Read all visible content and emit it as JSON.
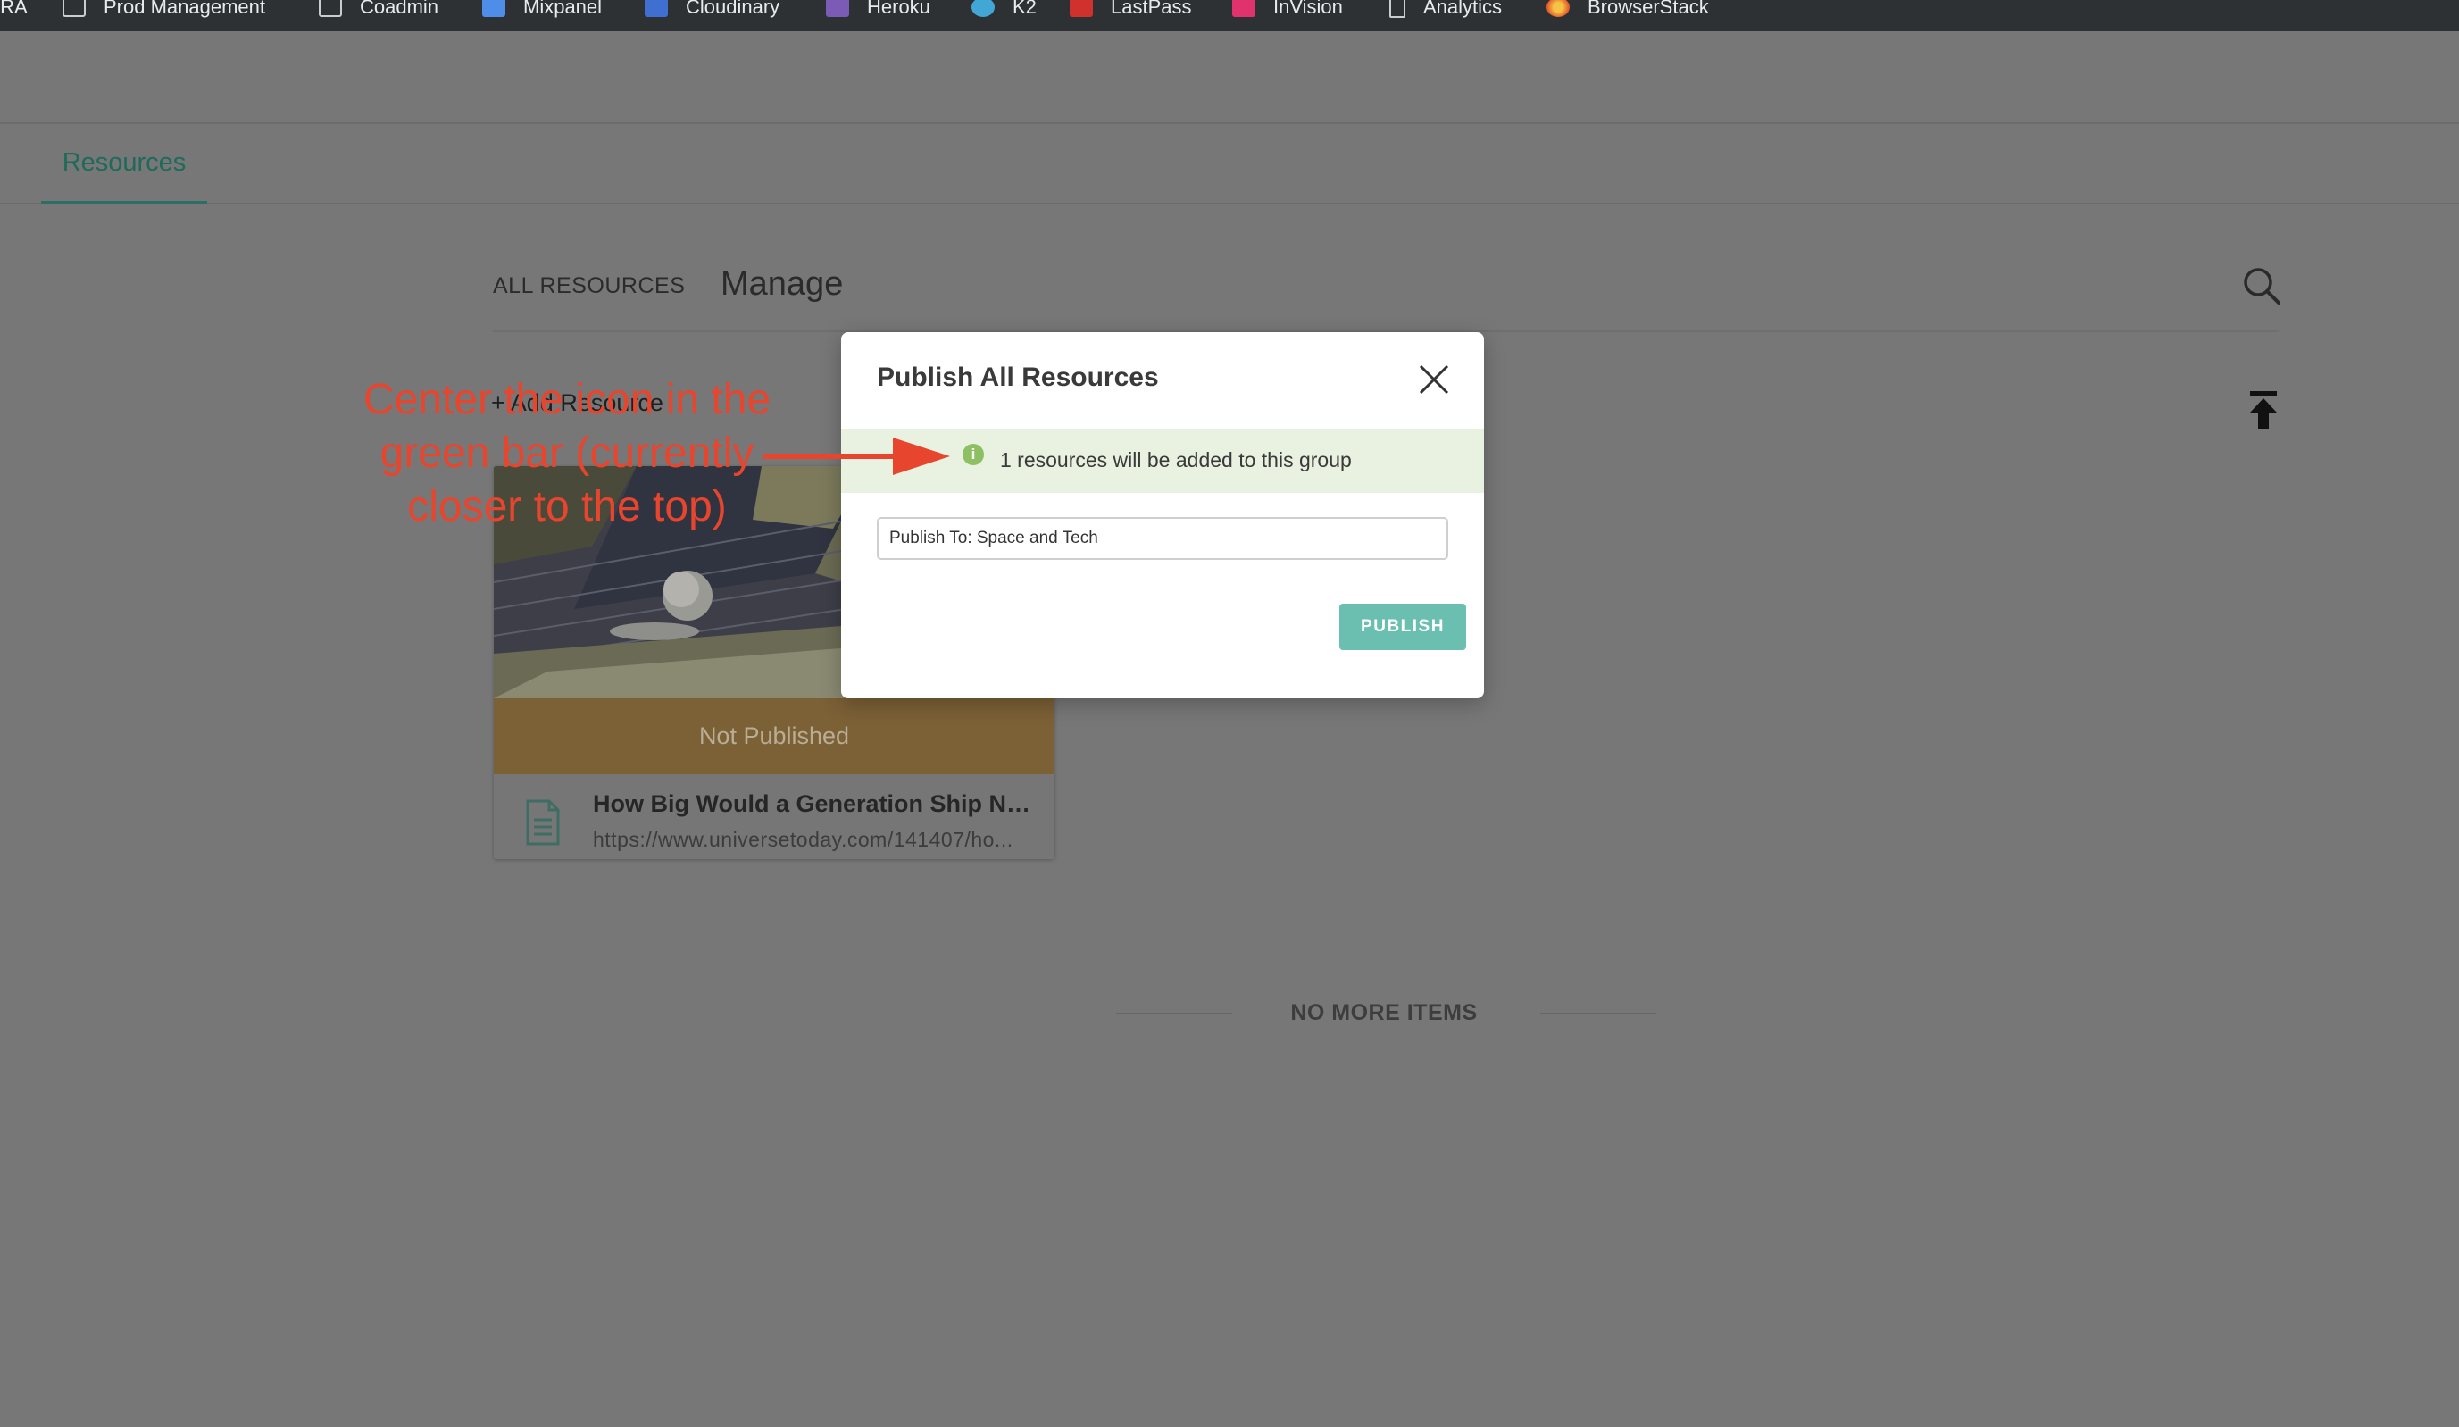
{
  "bookmarks": [
    {
      "label": "IRA",
      "icon": "none-icon"
    },
    {
      "label": "Prod Management",
      "icon": "folder-icon"
    },
    {
      "label": "Coadmin",
      "icon": "folder-icon"
    },
    {
      "label": "Mixpanel",
      "icon": "mixpanel-icon"
    },
    {
      "label": "Cloudinary",
      "icon": "cloudinary-icon"
    },
    {
      "label": "Heroku",
      "icon": "heroku-icon"
    },
    {
      "label": "K2",
      "icon": "k2-icon"
    },
    {
      "label": "LastPass",
      "icon": "lastpass-icon"
    },
    {
      "label": "InVision",
      "icon": "invision-icon"
    },
    {
      "label": "Analytics",
      "icon": "document-icon"
    },
    {
      "label": "BrowserStack",
      "icon": "browserstack-icon"
    }
  ],
  "tabs": {
    "resources": "Resources"
  },
  "header": {
    "all_resources": "ALL RESOURCES",
    "manage": "Manage",
    "add_resource": "+ Add Resource"
  },
  "card": {
    "status": "Not Published",
    "title": "How Big Would a Generation Ship Ne...",
    "url": "https://www.universetoday.com/141407/ho..."
  },
  "footer": {
    "no_more_items": "NO MORE ITEMS"
  },
  "modal": {
    "title": "Publish All Resources",
    "info_icon_glyph": "i",
    "info_text": "1 resources will be added to this group",
    "publish_to_value": "Publish To: Space and Tech",
    "publish_button": "PUBLISH"
  },
  "annotation": {
    "text": "Center the icon in the green bar (currently closer to the top)",
    "color": "#e8452e"
  },
  "colors": {
    "accent_teal": "#6bbfb0",
    "tab_active": "#1e6a5b",
    "info_bar_bg": "#e9f1e0",
    "info_icon": "#8dc063",
    "overlay": "#777777"
  }
}
